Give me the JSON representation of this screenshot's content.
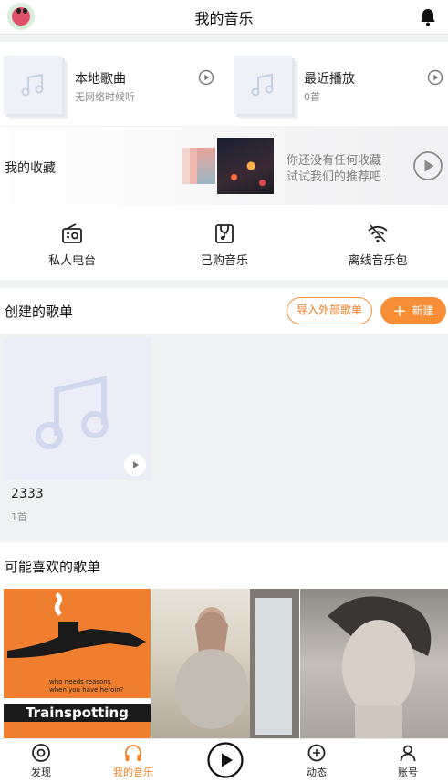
{
  "header": {
    "title": "我的音乐",
    "avatar_icon": "avatar-icon",
    "bell_icon": "bell-icon"
  },
  "top_cards": [
    {
      "title": "本地歌曲",
      "subtitle": "无网络时候听"
    },
    {
      "title": "最近播放",
      "subtitle": "0首"
    }
  ],
  "favorites": {
    "label": "我的收藏",
    "line1": "你还没有任何收藏",
    "line2": "试试我们的推荐吧"
  },
  "quick_entries": [
    {
      "label": "私人电台",
      "icon": "radio-icon"
    },
    {
      "label": "已购音乐",
      "icon": "purchased-bag-icon"
    },
    {
      "label": "离线音乐包",
      "icon": "offline-wifi-icon"
    }
  ],
  "created": {
    "title": "创建的歌单",
    "import_label": "导入外部歌单",
    "new_label": "新建",
    "playlists": [
      {
        "name": "2333",
        "count": "1首"
      }
    ]
  },
  "recommended": {
    "title": "可能喜欢的歌单",
    "tiles": [
      {
        "caption": "Trainspotting",
        "tagline_1": "who needs reasons",
        "tagline_2": "when you have heroin?"
      },
      {
        "caption": ""
      },
      {
        "caption": ""
      }
    ]
  },
  "tabbar": {
    "tabs": [
      {
        "label": "发现",
        "icon": "discover-icon"
      },
      {
        "label": "我的音乐",
        "icon": "headphones-icon",
        "active": true
      },
      {
        "label": "",
        "icon": "play-circle-icon"
      },
      {
        "label": "动态",
        "icon": "feed-icon"
      },
      {
        "label": "账号",
        "icon": "account-icon"
      }
    ]
  },
  "colors": {
    "accent": "#f78d35",
    "active_tab": "#f5832a"
  }
}
